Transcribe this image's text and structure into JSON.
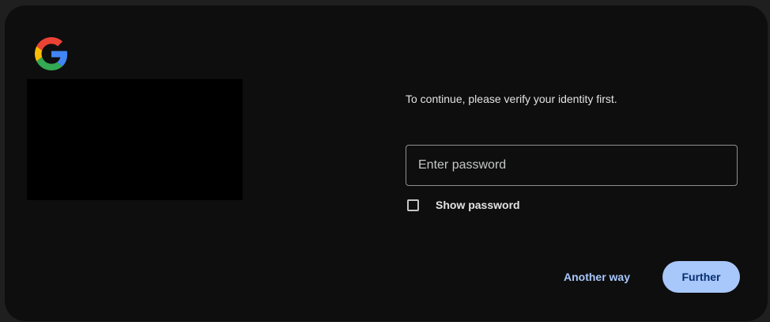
{
  "brand": {
    "logo_icon": "google-g-logo-icon",
    "colors": {
      "blue": "#4285F4",
      "red": "#EA4335",
      "yellow": "#FBBC05",
      "green": "#34A853"
    }
  },
  "verify": {
    "prompt": "To continue, please verify your identity first.",
    "password_placeholder": "Enter password",
    "password_value": "",
    "show_password_label": "Show password",
    "show_password_checked": false
  },
  "actions": {
    "another_way_label": "Another way",
    "further_label": "Further"
  },
  "theme": {
    "background": "#1f1f1f",
    "card": "#0e0e0e",
    "accent": "#a8c7fa",
    "accent_text": "#062e6f"
  }
}
